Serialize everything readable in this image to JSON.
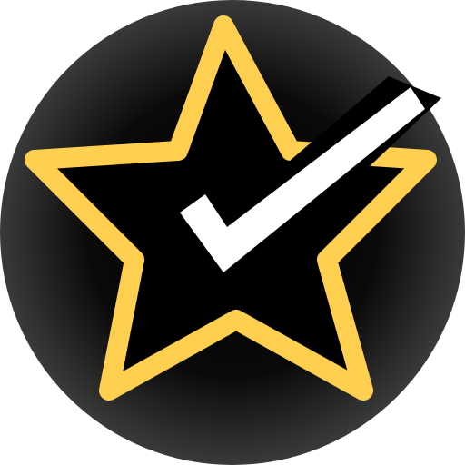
{
  "icon": {
    "name": "star-check-badge",
    "colors": {
      "background_outer": "#000000",
      "background_inner": "#3a3a3a",
      "star_outline": "#ffcf4f",
      "star_fill": "#000000",
      "checkmark": "#ffffff"
    }
  }
}
